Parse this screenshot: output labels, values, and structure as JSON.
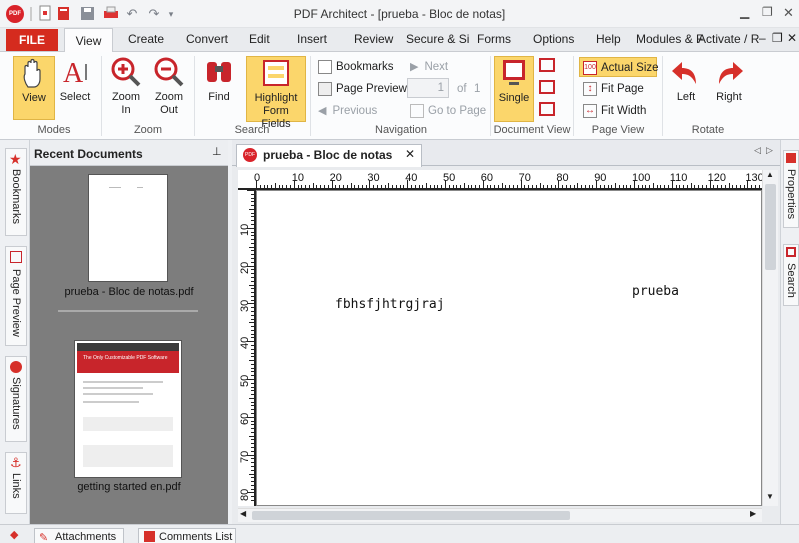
{
  "window": {
    "title": "PDF Architect  - [prueba - Bloc de notas]",
    "logo_text": "PDF",
    "controls": [
      "minimize-icon",
      "restore-icon",
      "close-icon"
    ]
  },
  "quick_access": {
    "icons": [
      "new-icon",
      "open-icon",
      "save-icon",
      "print-icon",
      "undo-icon",
      "redo-icon",
      "customize-dropdown-icon"
    ]
  },
  "ribbon_tabs": {
    "file": "FILE",
    "view": "View",
    "create": "Create",
    "convert": "Convert",
    "edit": "Edit",
    "insert": "Insert",
    "review": "Review",
    "secure": "Secure & Si",
    "forms": "Forms",
    "options": "Options",
    "help": "Help",
    "modules": "Modules & F",
    "activate": "Activate / R",
    "right_icons": [
      "minimize-ribbon-icon",
      "restore-ribbon-icon",
      "close-doc-icon"
    ]
  },
  "ribbon": {
    "modes": {
      "label": "Modes",
      "view": "View",
      "select": "Select"
    },
    "zoom": {
      "label": "Zoom",
      "zoom_in_1": "Zoom",
      "zoom_in_2": "In",
      "zoom_out_1": "Zoom",
      "zoom_out_2": "Out"
    },
    "search": {
      "label": "Search",
      "find": "Find",
      "highlight_1": "Highlight",
      "highlight_2": "Form Fields"
    },
    "navigation": {
      "label": "Navigation",
      "bookmarks": "Bookmarks",
      "page_preview": "Page Preview",
      "previous": "Previous",
      "next": "Next",
      "page_value": "1",
      "of": "of",
      "total_pages": "1",
      "go_to_page": "Go to Page"
    },
    "document_view": {
      "label": "Document View",
      "single": "Single"
    },
    "page_view": {
      "label": "Page View",
      "actual_size": "Actual Size",
      "fit_page": "Fit Page",
      "fit_width": "Fit Width"
    },
    "rotate": {
      "label": "Rotate",
      "left": "Left",
      "right": "Right"
    },
    "accent": "#fbd66b"
  },
  "left_tabs": {
    "bookmarks": "Bookmarks",
    "page_preview": "Page Preview",
    "signatures": "Signatures",
    "links": "Links"
  },
  "recent": {
    "title": "Recent Documents",
    "docs": [
      {
        "name": "prueba - Bloc de notas.pdf"
      },
      {
        "name": "getting started en.pdf",
        "header": "The Only Customizable PDF Software"
      }
    ]
  },
  "doc_tab": {
    "label": "prueba - Bloc de notas"
  },
  "ruler": {
    "h": [
      "0",
      "10",
      "20",
      "30",
      "40",
      "50",
      "60",
      "70",
      "80",
      "90",
      "100",
      "110",
      "120",
      "130"
    ],
    "v": [
      "10",
      "20",
      "30",
      "40",
      "50",
      "60",
      "70",
      "80"
    ]
  },
  "page_text": {
    "left": "fbhsfjhtrgjraj",
    "right": "prueba"
  },
  "right_tabs": {
    "properties": "Properties",
    "search": "Search"
  },
  "bottom_tabs": {
    "attachments": "Attachments",
    "comments": "Comments List"
  }
}
